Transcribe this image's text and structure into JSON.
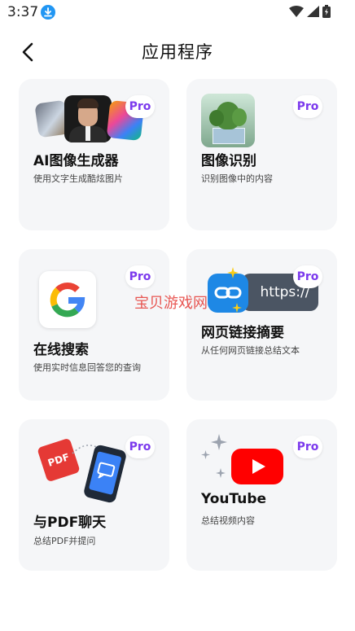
{
  "status": {
    "time": "3:37"
  },
  "header": {
    "title": "应用程序"
  },
  "watermark": "宝贝游戏网",
  "cards": [
    {
      "title": "AI图像生成器",
      "desc": "使用文字生成酷炫图片",
      "badge": "Pro"
    },
    {
      "title": "图像识别",
      "desc": "识别图像中的内容",
      "badge": "Pro"
    },
    {
      "title": "在线搜索",
      "desc": "使用实时信息回答您的查询",
      "badge": "Pro"
    },
    {
      "title": "网页链接摘要",
      "desc": "从任何网页链接总结文本",
      "badge": "Pro",
      "url_text": "https://"
    },
    {
      "title": "与PDF聊天",
      "desc": "总结PDF并提问",
      "badge": "Pro",
      "pdf_text": "PDF"
    },
    {
      "title": "YouTube",
      "desc": "总结视频内容",
      "badge": "Pro"
    }
  ],
  "colors": {
    "pro": "#7c3aed",
    "card_bg": "#f5f6f8",
    "youtube": "#ff0000",
    "pdf": "#e53935"
  }
}
